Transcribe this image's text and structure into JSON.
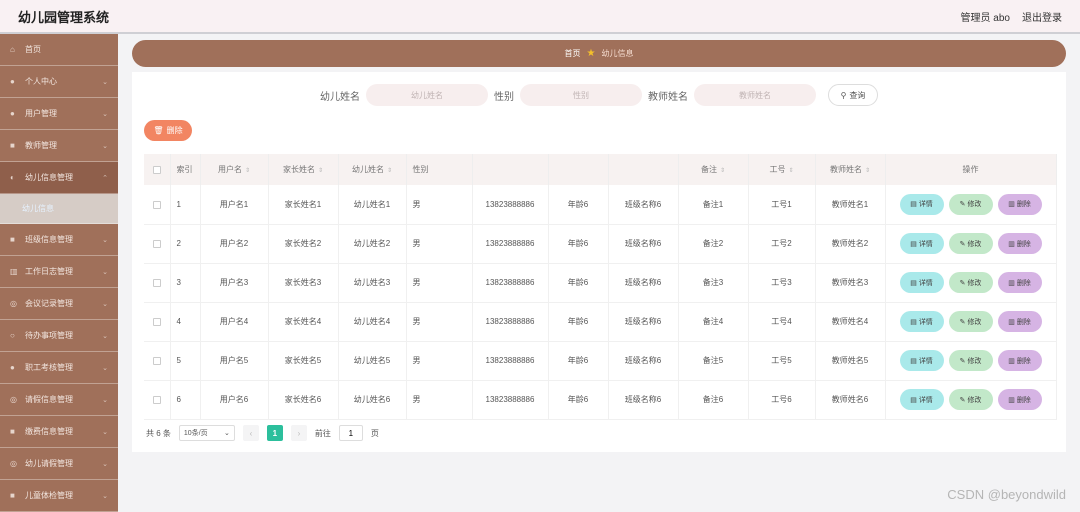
{
  "header": {
    "title": "幼儿园管理系统",
    "user": "管理员 abo",
    "logout": "退出登录"
  },
  "sidebar": {
    "items": [
      {
        "label": "首页",
        "icon": "home-icon",
        "glyph": "⌂"
      },
      {
        "label": "个人中心",
        "icon": "user-icon",
        "glyph": "●"
      },
      {
        "label": "用户管理",
        "icon": "users-icon",
        "glyph": "●"
      },
      {
        "label": "教师管理",
        "icon": "teacher-icon",
        "glyph": "■"
      },
      {
        "label": "幼儿信息管理",
        "icon": "child-icon",
        "glyph": "◐"
      },
      {
        "label": "幼儿信息",
        "sub": true
      },
      {
        "label": "班级信息管理",
        "icon": "class-icon",
        "glyph": "■"
      },
      {
        "label": "工作日志管理",
        "icon": "log-icon",
        "glyph": "▥"
      },
      {
        "label": "会议记录管理",
        "icon": "meeting-icon",
        "glyph": "◎"
      },
      {
        "label": "待办事项管理",
        "icon": "todo-icon",
        "glyph": "○"
      },
      {
        "label": "职工考核管理",
        "icon": "staff-icon",
        "glyph": "●"
      },
      {
        "label": "请假信息管理",
        "icon": "leave-icon",
        "glyph": "◎"
      },
      {
        "label": "缴费信息管理",
        "icon": "fee-icon",
        "glyph": "■"
      },
      {
        "label": "幼儿请假管理",
        "icon": "child-leave-icon",
        "glyph": "◎"
      },
      {
        "label": "儿童体检管理",
        "icon": "health-icon",
        "glyph": "■"
      }
    ]
  },
  "breadcrumb": {
    "home": "首页",
    "current": "幼儿信息"
  },
  "search": {
    "child_label": "幼儿姓名",
    "child_placeholder": "幼儿姓名",
    "gender_label": "性别",
    "gender_placeholder": "性别",
    "teacher_label": "教师姓名",
    "teacher_placeholder": "教师姓名",
    "query": "查询"
  },
  "actions": {
    "delete": "删除"
  },
  "table": {
    "headers": {
      "index": "索引",
      "username": "用户名",
      "parent": "家长姓名",
      "child": "幼儿姓名",
      "gender": "性别",
      "remark": "备注",
      "jobno": "工号",
      "teacher": "教师姓名",
      "ops": "操作"
    },
    "rows": [
      {
        "index": "1",
        "username": "用户名1",
        "parent": "家长姓名1",
        "child": "幼儿姓名1",
        "gender": "男",
        "phone": "13823888886",
        "age": "年龄6",
        "class": "班级名称6",
        "remark": "备注1",
        "jobno": "工号1",
        "teacher": "教师姓名1"
      },
      {
        "index": "2",
        "username": "用户名2",
        "parent": "家长姓名2",
        "child": "幼儿姓名2",
        "gender": "男",
        "phone": "13823888886",
        "age": "年龄6",
        "class": "班级名称6",
        "remark": "备注2",
        "jobno": "工号2",
        "teacher": "教师姓名2"
      },
      {
        "index": "3",
        "username": "用户名3",
        "parent": "家长姓名3",
        "child": "幼儿姓名3",
        "gender": "男",
        "phone": "13823888886",
        "age": "年龄6",
        "class": "班级名称6",
        "remark": "备注3",
        "jobno": "工号3",
        "teacher": "教师姓名3"
      },
      {
        "index": "4",
        "username": "用户名4",
        "parent": "家长姓名4",
        "child": "幼儿姓名4",
        "gender": "男",
        "phone": "13823888886",
        "age": "年龄6",
        "class": "班级名称6",
        "remark": "备注4",
        "jobno": "工号4",
        "teacher": "教师姓名4"
      },
      {
        "index": "5",
        "username": "用户名5",
        "parent": "家长姓名5",
        "child": "幼儿姓名5",
        "gender": "男",
        "phone": "13823888886",
        "age": "年龄6",
        "class": "班级名称6",
        "remark": "备注5",
        "jobno": "工号5",
        "teacher": "教师姓名5"
      },
      {
        "index": "6",
        "username": "用户名6",
        "parent": "家长姓名6",
        "child": "幼儿姓名6",
        "gender": "男",
        "phone": "13823888886",
        "age": "年龄6",
        "class": "班级名称6",
        "remark": "备注6",
        "jobno": "工号6",
        "teacher": "教师姓名6"
      }
    ],
    "row_actions": {
      "detail": "详情",
      "edit": "修改",
      "delete": "删除"
    }
  },
  "pagination": {
    "total": "共 6 条",
    "page_size": "10条/页",
    "current": "1",
    "goto_prefix": "前往",
    "goto_value": "1",
    "goto_suffix": "页"
  },
  "watermark": "CSDN @beyondwild",
  "colors": {
    "sidebar": "#a0705a",
    "accent_orange": "#f28562",
    "detail_btn": "#a9e9ea",
    "edit_btn": "#c2e8c9",
    "delete_btn": "#d6b4e4",
    "page_active": "#2cbf9c"
  }
}
